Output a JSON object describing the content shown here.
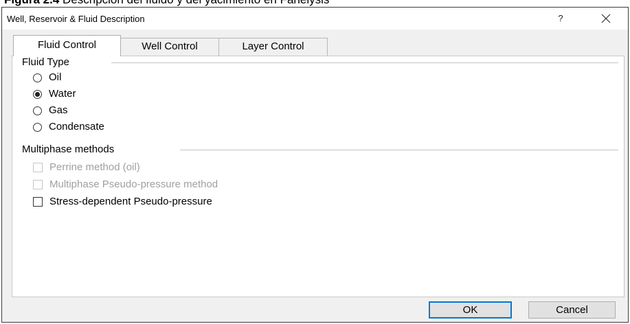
{
  "caption": {
    "bold": "Figura 2.4",
    "text": " Descripción del fluido y del yacimiento en Fanelysis"
  },
  "window": {
    "title": "Well, Reservoir & Fluid Description",
    "help_label": "?"
  },
  "tabs": [
    {
      "label": "Fluid Control",
      "active": true
    },
    {
      "label": "Well Control",
      "active": false
    },
    {
      "label": "Layer Control",
      "active": false
    }
  ],
  "fluid_type": {
    "label": "Fluid Type",
    "options": [
      {
        "label": "Oil",
        "checked": false
      },
      {
        "label": "Water",
        "checked": true
      },
      {
        "label": "Gas",
        "checked": false
      },
      {
        "label": "Condensate",
        "checked": false
      }
    ]
  },
  "multiphase": {
    "label": "Multiphase methods",
    "options": [
      {
        "label": "Perrine method (oil)",
        "checked": false,
        "enabled": false
      },
      {
        "label": "Multiphase Pseudo-pressure method",
        "checked": false,
        "enabled": false
      },
      {
        "label": "Stress-dependent Pseudo-pressure",
        "checked": false,
        "enabled": true
      }
    ]
  },
  "buttons": {
    "ok": "OK",
    "cancel": "Cancel"
  },
  "icons": {
    "close": "close-icon"
  }
}
